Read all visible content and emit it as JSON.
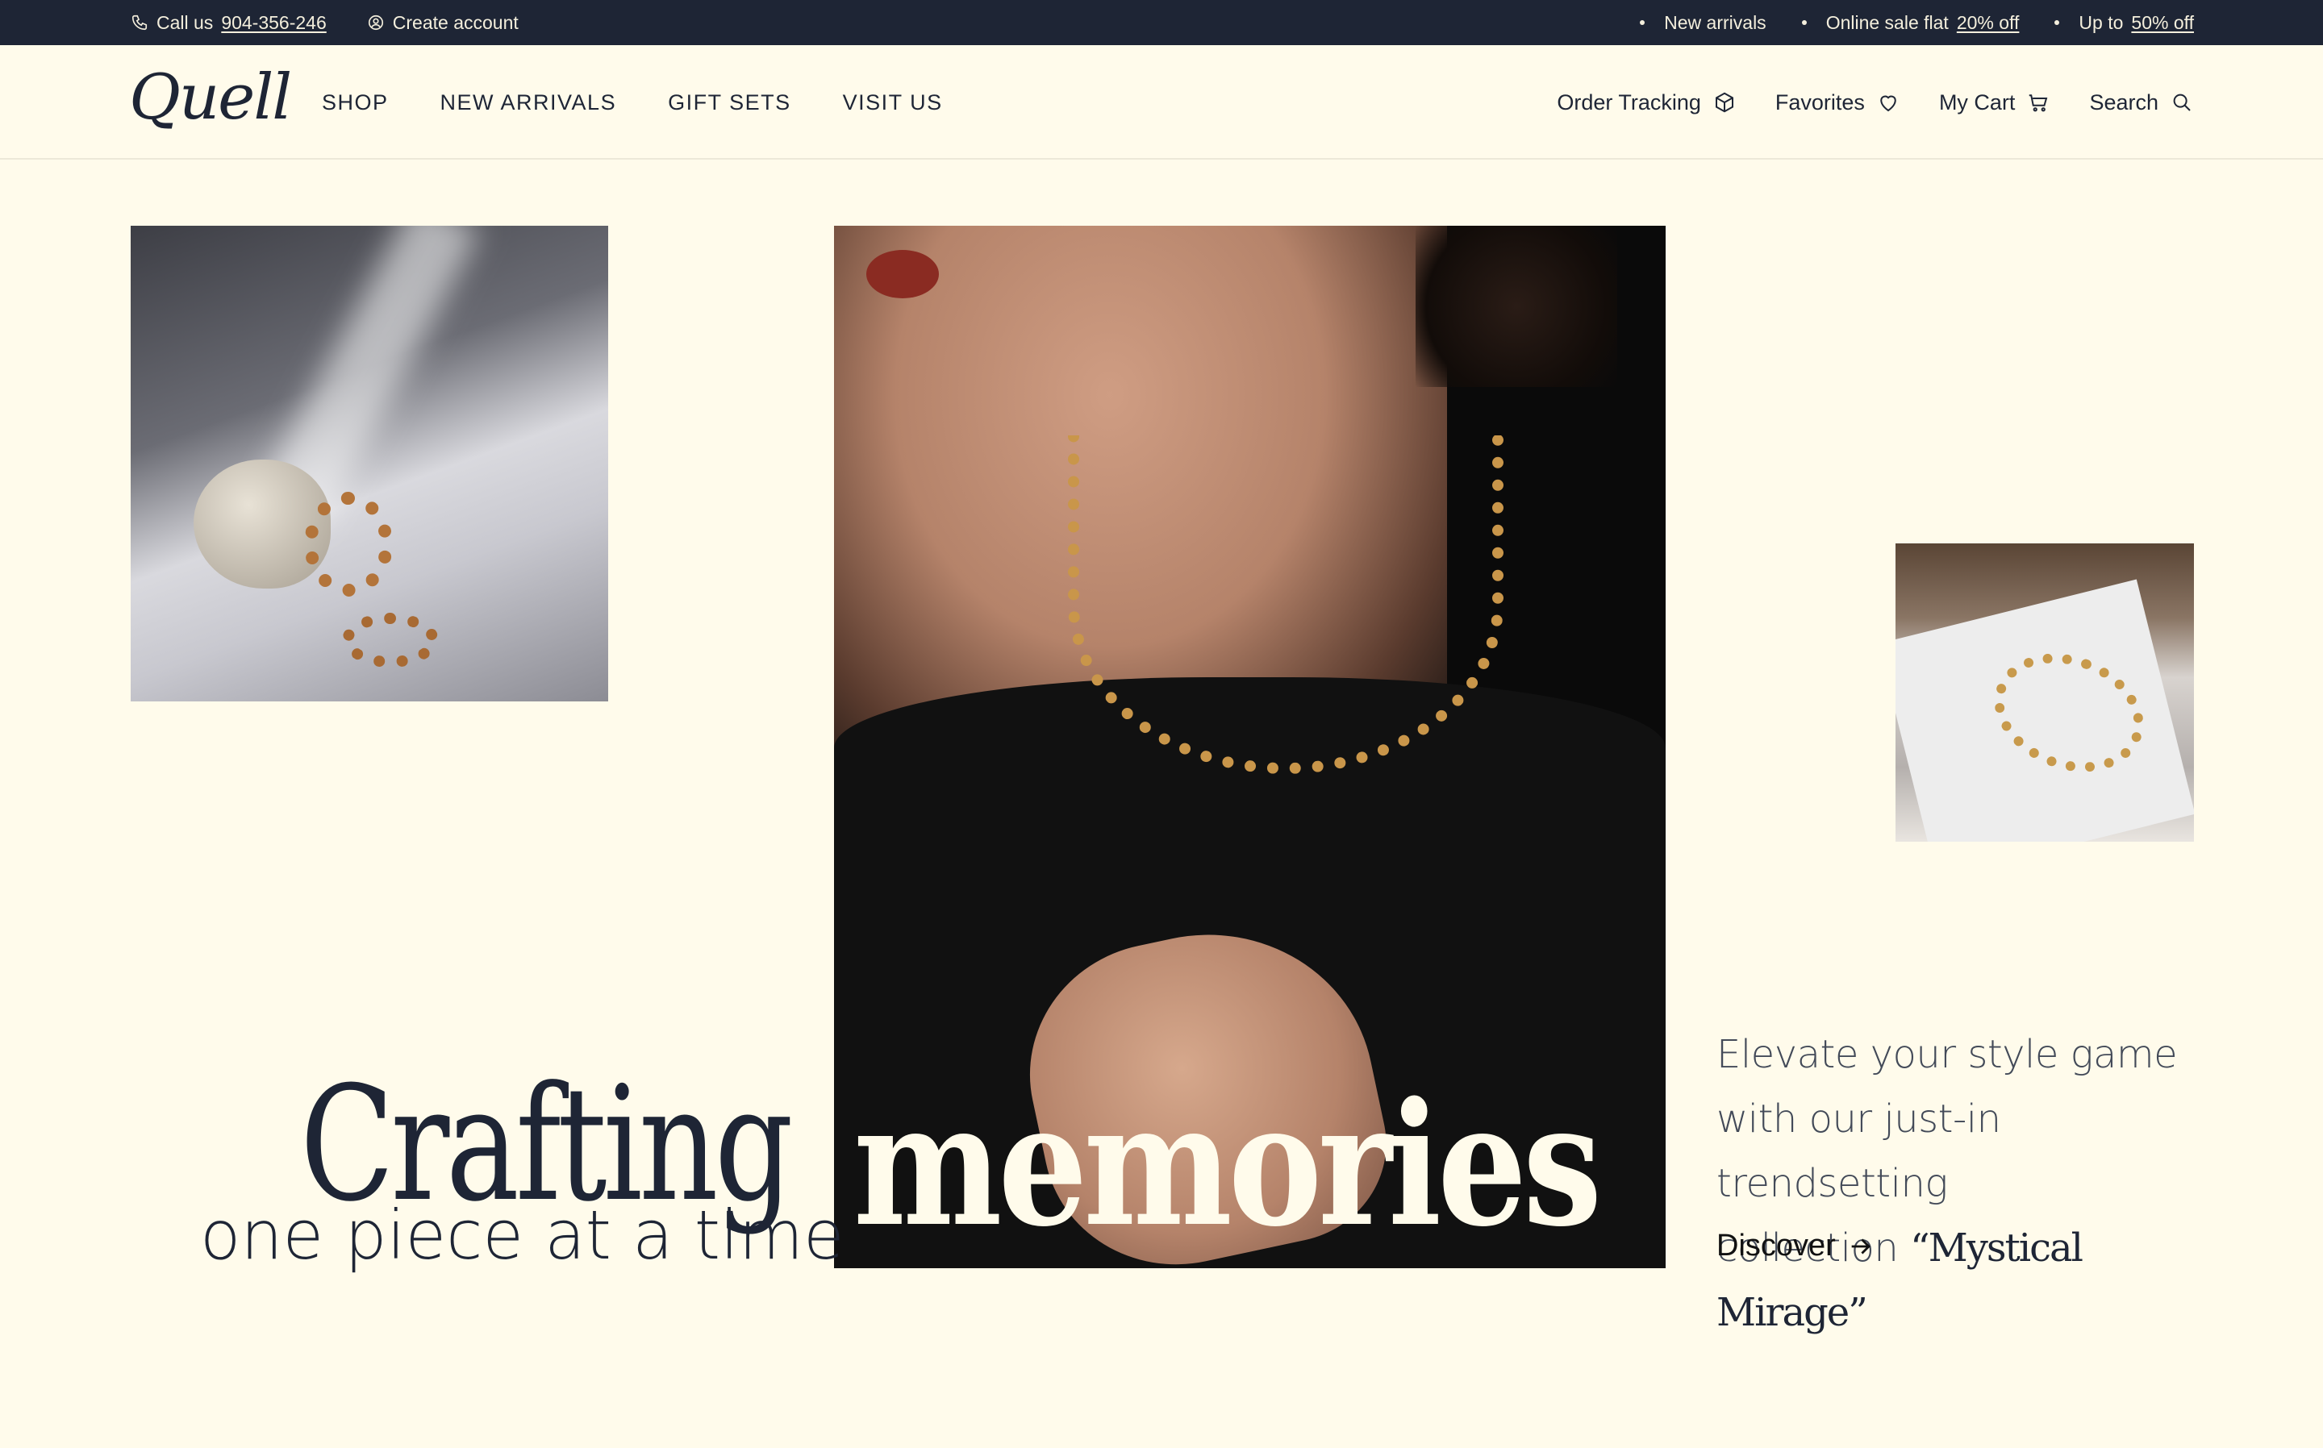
{
  "topbar": {
    "call_prefix": "Call us",
    "phone": "904-356-246",
    "create_account": "Create account",
    "announcements": [
      "New arrivals"
    ],
    "sale_prefix": "Online sale flat",
    "sale_value": "20% off",
    "upto_prefix": "Up to",
    "upto_value": "50% off"
  },
  "header": {
    "logo": "Quell",
    "nav": [
      "SHOP",
      "NEW ARRIVALS",
      "GIFT SETS",
      "VISIT US"
    ],
    "utilities": {
      "order_tracking": "Order Tracking",
      "favorites": "Favorites",
      "cart": "My Cart",
      "search": "Search"
    }
  },
  "hero": {
    "headline_part1": "Crafting",
    "headline_part2": "memories",
    "tagline": "one piece at a time",
    "promo_line1": "Elevate your style game",
    "promo_line2": "with our just-in trendsetting",
    "promo_line3_prefix": "collection",
    "collection_name": "“Mystical Mirage”",
    "cta": "Discover"
  },
  "colors": {
    "background": "#fffbeb",
    "topbar": "#1e2535",
    "text_dark": "#1e2535",
    "headline_light": "#fffbeb"
  },
  "icons": [
    "phone-icon",
    "user-circle-icon",
    "box-icon",
    "heart-icon",
    "cart-icon",
    "search-icon",
    "arrow-right-icon"
  ]
}
